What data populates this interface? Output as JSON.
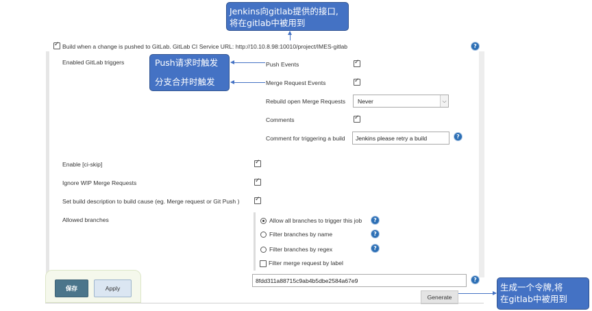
{
  "main_checkbox": {
    "label": "Build when a change is pushed to GitLab. GitLab CI Service URL: http://10.10.8.98:10010/project/IMES-gitlab",
    "checked": true
  },
  "gitlab_triggers": {
    "section_label": "Enabled GitLab triggers",
    "push_events": "Push Events",
    "merge_request_events": "Merge Request Events",
    "rebuild_label": "Rebuild open Merge Requests",
    "rebuild_value": "Never",
    "comments": "Comments",
    "comment_trigger_label": "Comment for triggering a build",
    "comment_trigger_value": "Jenkins please retry a build"
  },
  "options": {
    "enable_ci_skip": "Enable [ci-skip]",
    "ignore_wip": "Ignore WIP Merge Requests",
    "set_build_description": "Set build description to build cause (eg. Merge request or Git Push )"
  },
  "branches": {
    "label": "Allowed branches",
    "allow_all": "Allow all branches to trigger this job",
    "filter_by_name": "Filter branches by name",
    "filter_by_regex": "Filter branches by regex",
    "filter_merge_by_label": "Filter merge request by label"
  },
  "secret_token": {
    "value": "8fdd311a88715c9ab4b5dbe2584a67e9"
  },
  "buttons": {
    "save": "保存",
    "apply": "Apply",
    "generate": "Generate"
  },
  "annotations": {
    "top_line1": "Jenkins向gitlab提供的接口,",
    "top_line2": "将在gitlab中被用到",
    "push": "Push请求时触发",
    "merge": "分支合并时触发",
    "token_line1": "生成一个令牌,将",
    "token_line2": "在gitlab中被用到"
  },
  "colors": {
    "callout_fill": "#4472c4",
    "save_button": "#4b758b",
    "help_icon": "#2c6fb5"
  },
  "icons": [
    "checkbox-icon",
    "help-icon",
    "radio-icon",
    "dropdown-arrow-icon"
  ]
}
